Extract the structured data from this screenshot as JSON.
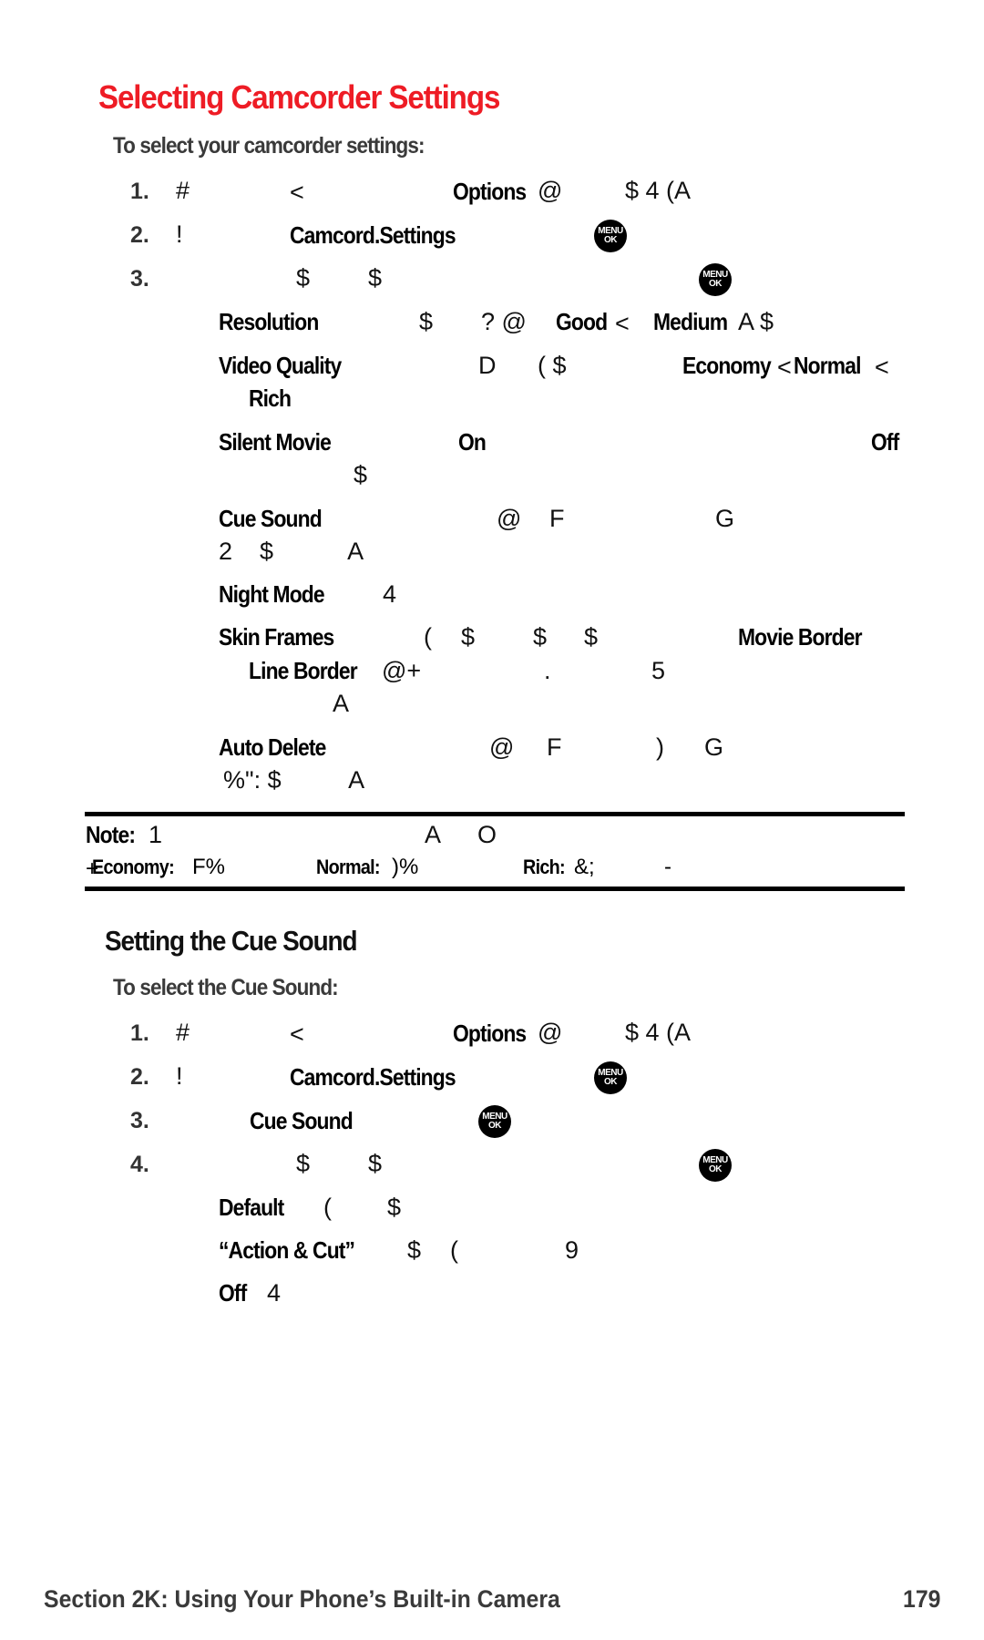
{
  "page": {
    "title": "Selecting Camcorder Settings",
    "section1": {
      "subtitle": "To select your camcorder settings:",
      "steps": [
        {
          "num": "1.",
          "parts": [
            "#",
            "<",
            "Options",
            "@",
            "$ 4 (A"
          ]
        },
        {
          "num": "2.",
          "parts": [
            "!",
            "Camcord.Settings"
          ],
          "icon": "menu-ok"
        },
        {
          "num": "3.",
          "parts": [
            "$",
            "$"
          ],
          "icon": "menu-ok"
        }
      ],
      "options": [
        {
          "label": "Resolution",
          "g1": "$",
          "g2": "? @",
          "b1": "Good",
          "g3": "<",
          "b2": "Medium",
          "g4": "A $"
        },
        {
          "label": "Video Quality",
          "g1": "D",
          "g2": "( $",
          "b1": "Economy",
          "g3": "<",
          "b2": "Normal",
          "g4": "<",
          "cont": "Rich"
        },
        {
          "label": "Silent Movie",
          "b1": "On",
          "b2": "Off",
          "cont": "$"
        },
        {
          "label": "Cue Sound",
          "g1": "@",
          "g2": "F",
          "g3": "G",
          "cont": "2    $           A"
        },
        {
          "label": "Night Mode",
          "g1": "4"
        },
        {
          "label": "Skin Frames",
          "g1": "(",
          "g2": "$",
          "g3": "$",
          "g4": "$",
          "b1": "Movie Border",
          "cont_b": "Line Border",
          "cont_g1": "@+",
          "cont_g2": ".",
          "cont_g3": "5",
          "cont2": "A"
        },
        {
          "label": "Auto Delete",
          "g1": "@",
          "g2": "F",
          "g3": ")",
          "g4": "G",
          "cont": "%\": $          A"
        }
      ]
    },
    "note": {
      "label": "Note:",
      "line1_g1": "1",
      "line1_g2": "A",
      "line1_g3": "O",
      "economy_label": "Economy:",
      "economy_val": "F%",
      "normal_label": "Normal:",
      "normal_val": ")%",
      "rich_label": "Rich:",
      "rich_val": "&;",
      "dash": "-",
      "prefix": "+"
    },
    "section2": {
      "heading": "Setting the Cue Sound",
      "subtitle": "To select the Cue Sound:",
      "steps": [
        {
          "num": "1.",
          "parts": [
            "#",
            "<",
            "Options",
            "@",
            "$ 4 (A"
          ]
        },
        {
          "num": "2.",
          "parts": [
            "!",
            "Camcord.Settings"
          ],
          "icon": "menu-ok"
        },
        {
          "num": "3.",
          "parts": [
            "Cue Sound"
          ],
          "icon": "menu-ok"
        },
        {
          "num": "4.",
          "parts": [
            "$",
            "$"
          ],
          "icon": "menu-ok"
        }
      ],
      "options": [
        {
          "label": "Default",
          "g1": "(",
          "g2": "$"
        },
        {
          "label": "“Action & Cut”",
          "g1": "$",
          "g2": "(",
          "g3": "9"
        },
        {
          "label": "Off",
          "g1": "4"
        }
      ]
    },
    "menu_icon": {
      "line1": "MENU",
      "line2": "OK"
    },
    "footer": {
      "section": "Section 2K: Using Your Phone’s Built-in Camera",
      "page_number": "179"
    },
    "colors": {
      "title_red": "#ee1c25"
    }
  }
}
